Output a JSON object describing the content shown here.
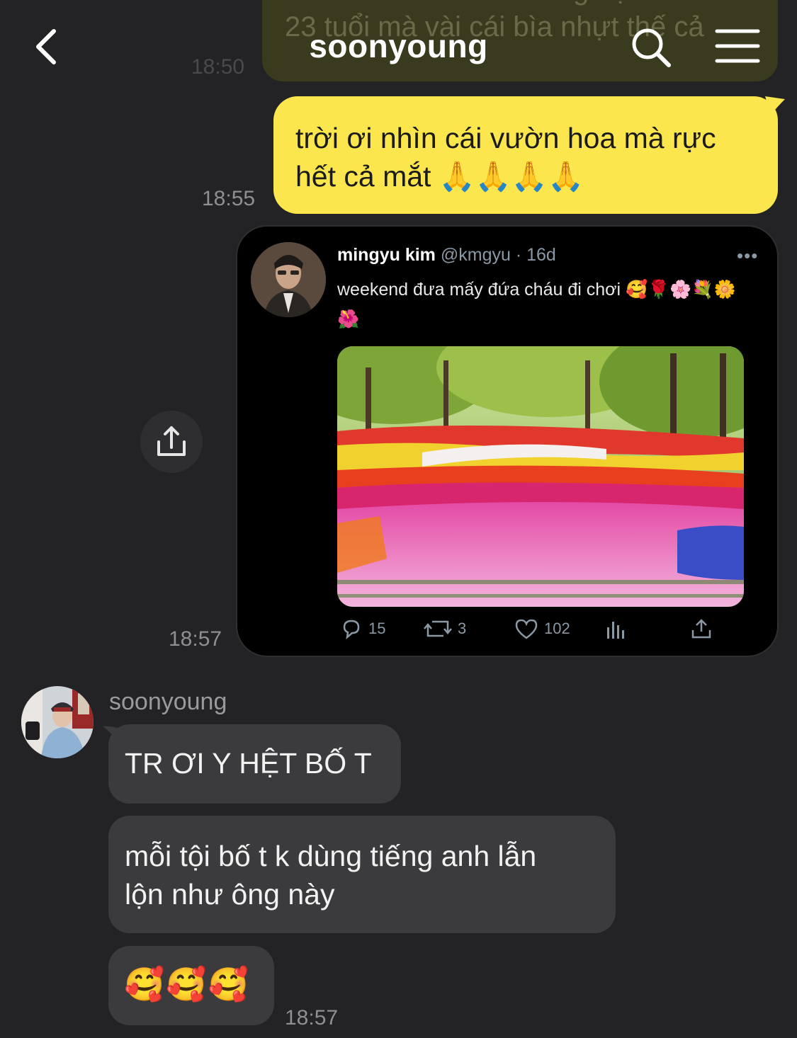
{
  "header": {
    "title": "soonyoung",
    "back_icon": "chevron-left-icon",
    "search_icon": "search-icon",
    "menu_icon": "hamburger-menu-icon"
  },
  "messages": {
    "previous": {
      "line1": "thể luôn chứ chả có ông nội nào",
      "line2": "23 tuổi mà vài cái bìa nhựt thế cả",
      "time": "18:50"
    },
    "outgoing_text": {
      "text_line1": "trời ơi nhìn cái vườn hoa mà rực",
      "text_line2": "hết cả mắt 🙏🙏🙏🙏",
      "time": "18:55"
    },
    "outgoing_tweet": {
      "author": "mingyu kim",
      "handle": "@kmgyu · 16d",
      "more": "•••",
      "text": "weekend đưa mấy đứa cháu đi chơi 🥰🌹🌸💐🌼🌺",
      "replies": "15",
      "retweets": "3",
      "likes": "102",
      "time": "18:57"
    },
    "incoming": {
      "sender": "soonyoung",
      "bubble1": "TR ƠI Y HỆT BỐ T",
      "bubble2_line1": "mỗi tội bố t k dùng tiếng anh lẫn",
      "bubble2_line2": "lộn như ông này",
      "bubble3": "🥰🥰🥰",
      "time": "18:57"
    }
  },
  "colors": {
    "background": "#232325",
    "outgoing_bubble": "#fbe64d",
    "incoming_bubble": "#3b3b3d",
    "timestamp": "#8e8e93"
  }
}
